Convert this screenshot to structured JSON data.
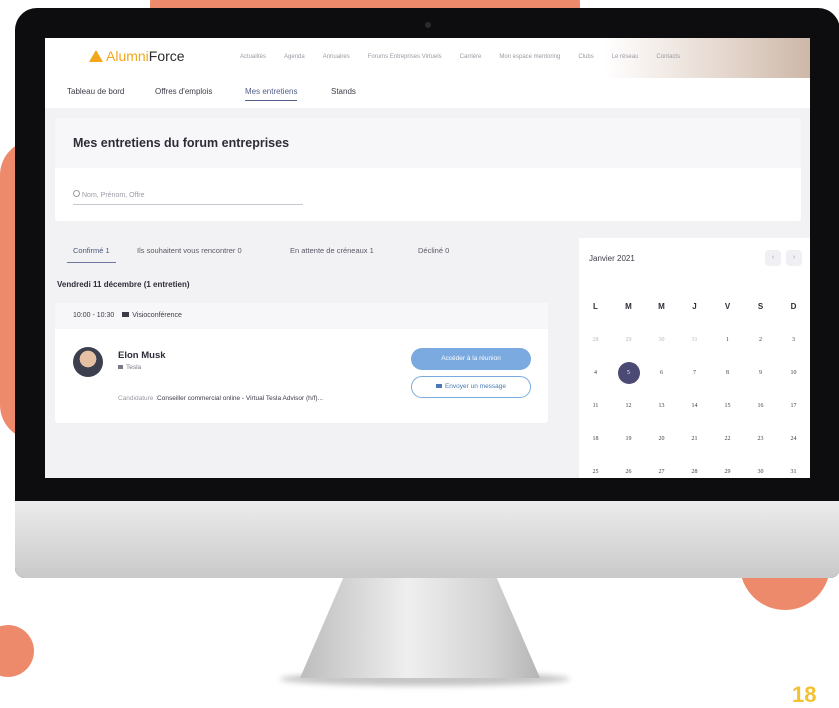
{
  "brand": {
    "logo_prefix": "Alumni",
    "logo_suffix": "Force",
    "accent": "#f2a71b"
  },
  "nav_links": [
    "Actualités",
    "Agenda",
    "Annuaires",
    "Forums Entreprises Virtuels",
    "Carrière",
    "Mon espace mentoring",
    "Clubs",
    "Le réseau",
    "Contacts"
  ],
  "tabs": [
    {
      "label": "Tableau de bord"
    },
    {
      "label": "Offres d'emplois"
    },
    {
      "label": "Mes entretiens",
      "active": true
    },
    {
      "label": "Stands"
    }
  ],
  "page": {
    "title": "Mes entretiens du forum entreprises",
    "search_placeholder": "Nom, Prénom, Offre"
  },
  "subtabs": [
    {
      "label": "Confirmé 1",
      "active": true
    },
    {
      "label": "Ils souhaitent vous rencontrer 0"
    },
    {
      "label": "En attente de créneaux 1"
    },
    {
      "label": "Décliné 0"
    }
  ],
  "day_heading": "Vendredi 11 décembre (1 entretien)",
  "interview": {
    "time": "10:00 - 10:30",
    "mode": "Visioconférence",
    "name": "Elon Musk",
    "company": "Tesla",
    "candidature_label": "Candidature :",
    "candidature_value": "Conseiller commercial online - Virtual Tesla Advisor (h/f)...",
    "join_button": "Accéder à la réunion",
    "message_button": "Envoyer un message"
  },
  "calendar": {
    "month": "Janvier 2021",
    "prev": "‹",
    "next": "›",
    "weekdays": [
      "L",
      "M",
      "M",
      "J",
      "V",
      "S",
      "D"
    ],
    "weeks": [
      [
        {
          "d": "28",
          "m": true
        },
        {
          "d": "29",
          "m": true
        },
        {
          "d": "30",
          "m": true
        },
        {
          "d": "31",
          "m": true
        },
        {
          "d": "1"
        },
        {
          "d": "2"
        },
        {
          "d": "3"
        }
      ],
      [
        {
          "d": "4"
        },
        {
          "d": "5",
          "sel": true
        },
        {
          "d": "6"
        },
        {
          "d": "7"
        },
        {
          "d": "8"
        },
        {
          "d": "9"
        },
        {
          "d": "10"
        }
      ],
      [
        {
          "d": "11"
        },
        {
          "d": "12"
        },
        {
          "d": "13"
        },
        {
          "d": "14"
        },
        {
          "d": "15"
        },
        {
          "d": "16"
        },
        {
          "d": "17"
        }
      ],
      [
        {
          "d": "18"
        },
        {
          "d": "19"
        },
        {
          "d": "20"
        },
        {
          "d": "21"
        },
        {
          "d": "22"
        },
        {
          "d": "23"
        },
        {
          "d": "24"
        }
      ],
      [
        {
          "d": "25"
        },
        {
          "d": "26"
        },
        {
          "d": "27"
        },
        {
          "d": "28"
        },
        {
          "d": "29"
        },
        {
          "d": "30"
        },
        {
          "d": "31"
        }
      ]
    ]
  },
  "corner_number": "18"
}
